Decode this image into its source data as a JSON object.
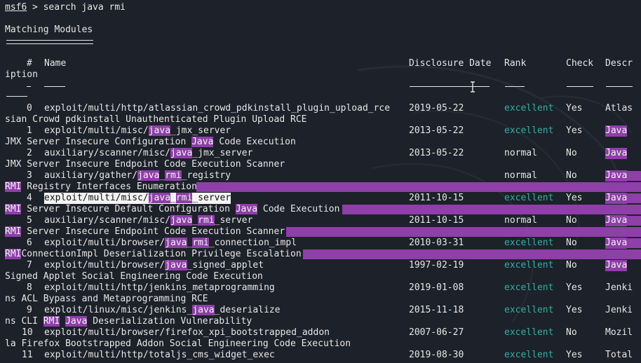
{
  "prompt": {
    "name": "msf6",
    "symbol": " > ",
    "command": "search java rmi"
  },
  "section_title": "Matching Modules",
  "headers": {
    "num": "#",
    "name": "Name",
    "date": "Disclosure Date",
    "rank": "Rank",
    "check": "Check",
    "descr_head": "Descr",
    "descr_tail": "iption"
  },
  "rows": [
    {
      "num": "0",
      "name_parts": [
        "exploit/multi/http/atlassian_crowd_pdkinstall_plugin_upload_rce"
      ],
      "date": "2019-05-22",
      "rank": "excellent",
      "check": "Yes",
      "desc_start": "Atlas",
      "desc_rest": "sian Crowd pdkinstall Unauthenticated Plugin Upload RCE"
    },
    {
      "num": "1",
      "name_parts": [
        "exploit/multi/misc/",
        "java",
        "_jmx_server"
      ],
      "date": "2013-05-22",
      "rank": "excellent",
      "check": "Yes",
      "desc_start": "Java",
      "desc_rest_parts": [
        "JMX Server Insecure Configuration ",
        "Java",
        " Code Execution"
      ]
    },
    {
      "num": "2",
      "name_parts": [
        "auxiliary/scanner/misc/",
        "java",
        "_jmx_server"
      ],
      "date": "2013-05-22",
      "rank": "normal",
      "check": "No",
      "desc_start": "Java",
      "desc_rest": "JMX Server Insecure Endpoint Code Execution Scanner"
    },
    {
      "num": "3",
      "name_parts": [
        "auxiliary/gather/",
        "java",
        "_",
        "rmi",
        "_registry"
      ],
      "date": "",
      "rank": "normal",
      "check": "No",
      "desc_start": "Java",
      "desc_rest_parts": [
        "RMI",
        " Registry Interfaces Enumeration"
      ]
    },
    {
      "num": "4",
      "name_parts": [
        "exploit/multi/misc/",
        "java",
        "_",
        "rmi",
        "_server"
      ],
      "date": "2011-10-15",
      "rank": "excellent",
      "check": "Yes",
      "desc_start": "Java",
      "desc_rest_parts": [
        "RMI",
        " Server Insecure Default Configuration ",
        "Java",
        " Code Execution"
      ]
    },
    {
      "num": "5",
      "name_parts": [
        "auxiliary/scanner/misc/",
        "java",
        "_",
        "rmi",
        "_server"
      ],
      "date": "2011-10-15",
      "rank": "normal",
      "check": "No",
      "desc_start": "Java",
      "desc_rest_parts": [
        "RMI",
        " Server Insecure Endpoint Code Execution Scanner"
      ]
    },
    {
      "num": "6",
      "name_parts": [
        "exploit/multi/browser/",
        "java",
        "_",
        "rmi",
        "_connection_impl"
      ],
      "date": "2010-03-31",
      "rank": "excellent",
      "check": "No",
      "desc_start": "Java",
      "desc_rest_parts": [
        "RMI",
        "ConnectionImpl Deserialization Privilege Escalation"
      ]
    },
    {
      "num": "7",
      "name_parts": [
        "exploit/multi/browser/",
        "java",
        "_signed_applet"
      ],
      "date": "1997-02-19",
      "rank": "excellent",
      "check": "No",
      "desc_start": "Java",
      "desc_rest": "Signed Applet Social Engineering Code Execution"
    },
    {
      "num": "8",
      "name_parts": [
        "exploit/multi/http/jenkins_metaprogramming"
      ],
      "date": "2019-01-08",
      "rank": "excellent",
      "check": "Yes",
      "desc_start": "Jenki",
      "desc_rest": "ns ACL Bypass and Metaprogramming RCE"
    },
    {
      "num": "9",
      "name_parts": [
        "exploit/linux/misc/jenkins_",
        "java",
        "_deserialize"
      ],
      "date": "2015-11-18",
      "rank": "excellent",
      "check": "Yes",
      "desc_start": "Jenki",
      "desc_rest_parts": [
        "ns CLI ",
        "RMI",
        " ",
        "Java",
        " Deserialization Vulnerability"
      ]
    },
    {
      "num": "10",
      "name_parts": [
        "exploit/multi/browser/firefox_xpi_bootstrapped_addon"
      ],
      "date": "2007-06-27",
      "rank": "excellent",
      "check": "No",
      "desc_start": "Mozil",
      "desc_rest": "la Firefox Bootstrapped Addon Social Engineering Code Execution"
    },
    {
      "num": "11",
      "name_parts": [
        "exploit/multi/http/totaljs_cms_widget_exec"
      ],
      "date": "2019-08-30",
      "rank": "excellent",
      "check": "Yes",
      "desc_start": "Total",
      "desc_rest": ""
    }
  ],
  "highlight_terms": [
    "java",
    "rmi"
  ],
  "colors": {
    "background": "#1d2129",
    "text": "#e6e6e6",
    "highlight": "#8e3fa8",
    "excellent": "#31b0a3",
    "selection": "#f4f4f4"
  },
  "icons": {
    "cursor": "i-beam-cursor-icon",
    "background": "kali-dragon-icon"
  }
}
